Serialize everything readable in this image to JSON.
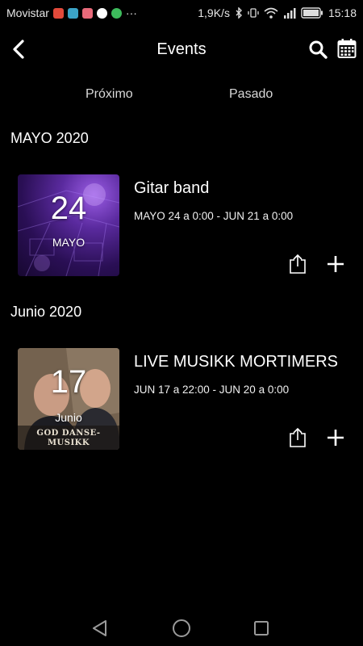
{
  "status_bar": {
    "carrier": "Movistar",
    "more": "···",
    "speed": "1,9K/s",
    "time": "15:18",
    "app_badge_colors": [
      "#e24a3b",
      "#3ba3c6",
      "#e86a7a",
      "#ffffff",
      "#3dbb5c"
    ]
  },
  "header": {
    "title": "Events",
    "back_icon": "chevron-left-icon",
    "search_icon": "search-icon",
    "calendar_icon": "calendar-icon"
  },
  "tabs": [
    {
      "label": "Próximo"
    },
    {
      "label": "Pasado"
    }
  ],
  "sections": [
    {
      "title": "MAYO 2020",
      "events": [
        {
          "day": "24",
          "month": "MAYO",
          "title": "Gitar band",
          "dates": "MAYO 24 a 0:00 - JUN 21 a 0:00"
        }
      ]
    },
    {
      "title": "Junio 2020",
      "events": [
        {
          "day": "17",
          "month": "Junio",
          "title": "LIVE MUSIKK MORTIMERS",
          "dates": "JUN 17 a 22:00 - JUN 20 a 0:00",
          "image_caption": "GOD DANSE-MUSIKK"
        }
      ]
    }
  ],
  "nav_bar": {
    "back_icon": "triangle-back-icon",
    "home_icon": "circle-home-icon",
    "recent_icon": "square-recent-icon"
  }
}
